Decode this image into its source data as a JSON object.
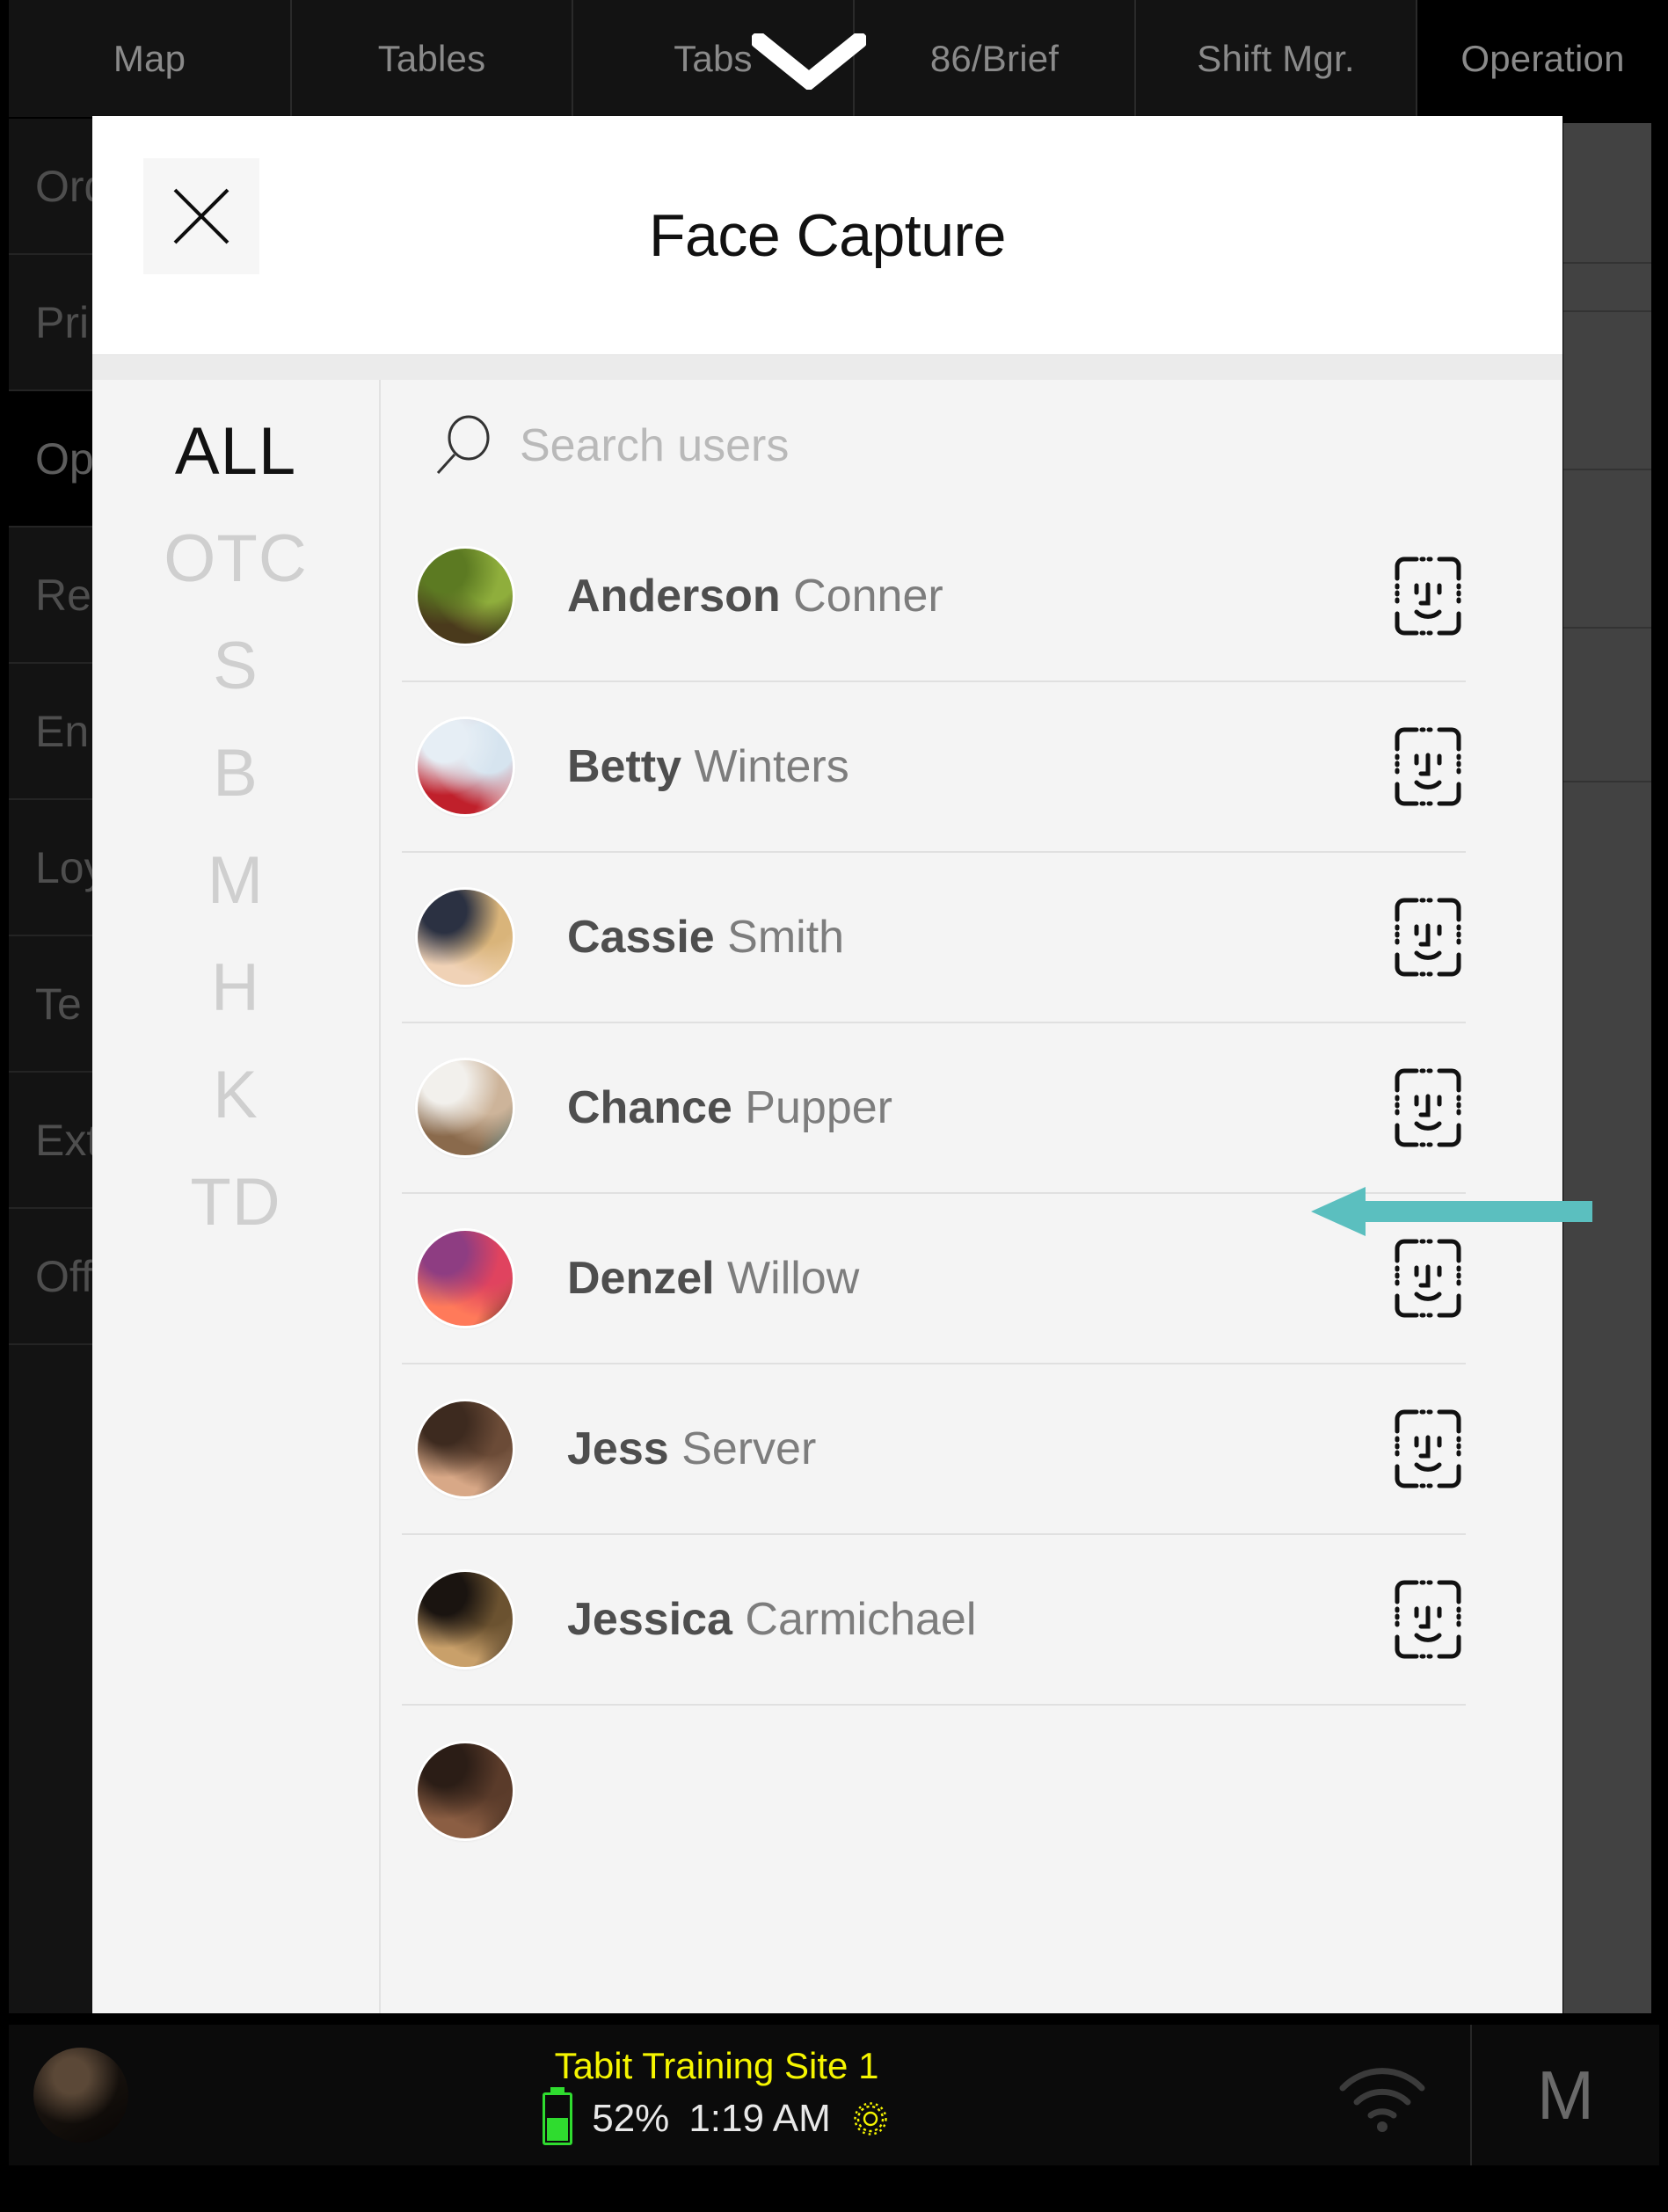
{
  "topnav": {
    "tabs": [
      {
        "label": "Map",
        "active": false
      },
      {
        "label": "Tables",
        "active": false
      },
      {
        "label": "Tabs",
        "active": false
      },
      {
        "label": "86/Brief",
        "active": false
      },
      {
        "label": "Shift Mgr.",
        "active": false
      },
      {
        "label": "Operation",
        "active": true
      }
    ],
    "chevron_icon": "chevron-down-icon"
  },
  "background": {
    "left_menu": [
      {
        "label": "Ord",
        "active": false
      },
      {
        "label": "Pri",
        "active": false
      },
      {
        "label": "Op",
        "active": true
      },
      {
        "label": "Re",
        "active": false
      },
      {
        "label": "En",
        "active": false
      },
      {
        "label": "Loy",
        "active": false
      },
      {
        "label": "Te",
        "active": false
      },
      {
        "label": "Ext",
        "active": false
      },
      {
        "label": "Off",
        "active": false
      }
    ]
  },
  "modal": {
    "title": "Face Capture",
    "close_icon": "close-icon",
    "search": {
      "placeholder": "Search users",
      "value": "",
      "icon": "search-icon"
    },
    "letter_filters": [
      {
        "label": "ALL",
        "active": true
      },
      {
        "label": "OTC",
        "active": false
      },
      {
        "label": "S",
        "active": false
      },
      {
        "label": "B",
        "active": false
      },
      {
        "label": "M",
        "active": false
      },
      {
        "label": "H",
        "active": false
      },
      {
        "label": "K",
        "active": false
      },
      {
        "label": "TD",
        "active": false
      }
    ],
    "users": [
      {
        "first_name": "Anderson",
        "last_name": "Conner",
        "avatar_desc": "mossy-forest-bridge-photo",
        "avatar_colors": [
          "#5c7a22",
          "#8fae3c",
          "#4a3a1c",
          "#2f4212"
        ],
        "face_capture_icon": "face-id-icon"
      },
      {
        "first_name": "Betty",
        "last_name": "Winters",
        "avatar_desc": "red-mitten-snow-heart-photo",
        "avatar_colors": [
          "#e6eef5",
          "#d6e4ef",
          "#c0202b",
          "#ffffff"
        ],
        "face_capture_icon": "face-id-icon"
      },
      {
        "first_name": "Cassie",
        "last_name": "Smith",
        "avatar_desc": "blonde-woman-selfie-photo",
        "avatar_colors": [
          "#2b3142",
          "#d9b47a",
          "#f0d2b6",
          "#e8c784"
        ],
        "face_capture_icon": "face-id-icon"
      },
      {
        "first_name": "Chance",
        "last_name": "Pupper",
        "avatar_desc": "tan-dog-window-photo",
        "avatar_colors": [
          "#f2f0ec",
          "#cdb49a",
          "#8a6a4c",
          "#3f8f9e"
        ],
        "face_capture_icon": "face-id-icon"
      },
      {
        "first_name": "Denzel",
        "last_name": "Willow",
        "avatar_desc": "pink-sunset-lone-tree-photo",
        "avatar_colors": [
          "#8e3d82",
          "#e0435f",
          "#ff7a5a",
          "#1a0a14"
        ],
        "face_capture_icon": "face-id-icon"
      },
      {
        "first_name": "Jess",
        "last_name": "Server",
        "avatar_desc": "woman-portrait-indoor-photo",
        "avatar_colors": [
          "#3d2a1f",
          "#6b4b37",
          "#d8a887",
          "#241712"
        ],
        "face_capture_icon": "face-id-icon"
      },
      {
        "first_name": "Jessica",
        "last_name": "Carmichael",
        "avatar_desc": "woman-with-drink-bar-photo",
        "avatar_colors": [
          "#1a1410",
          "#6b5230",
          "#c9a06a",
          "#0d0a08"
        ],
        "face_capture_icon": "face-id-icon"
      },
      {
        "first_name": "",
        "last_name": "",
        "avatar_desc": "partially-visible-avatar",
        "avatar_colors": [
          "#2b1d16",
          "#5a3b2a",
          "#8b5e43",
          "#17100c"
        ],
        "face_capture_icon": "face-id-icon"
      }
    ]
  },
  "annotation": {
    "arrow_color": "#5bbfbf",
    "points_to": "Cassie Smith face capture button"
  },
  "statusbar": {
    "site_name": "Tabit Training Site 1",
    "battery_percent": "52%",
    "battery_level": 52,
    "time": "1:19 AM",
    "gear_icon": "gear-icon",
    "wifi_icon": "wifi-icon",
    "user_initial": "M",
    "avatar_desc": "user-avatar-thumbnail"
  }
}
